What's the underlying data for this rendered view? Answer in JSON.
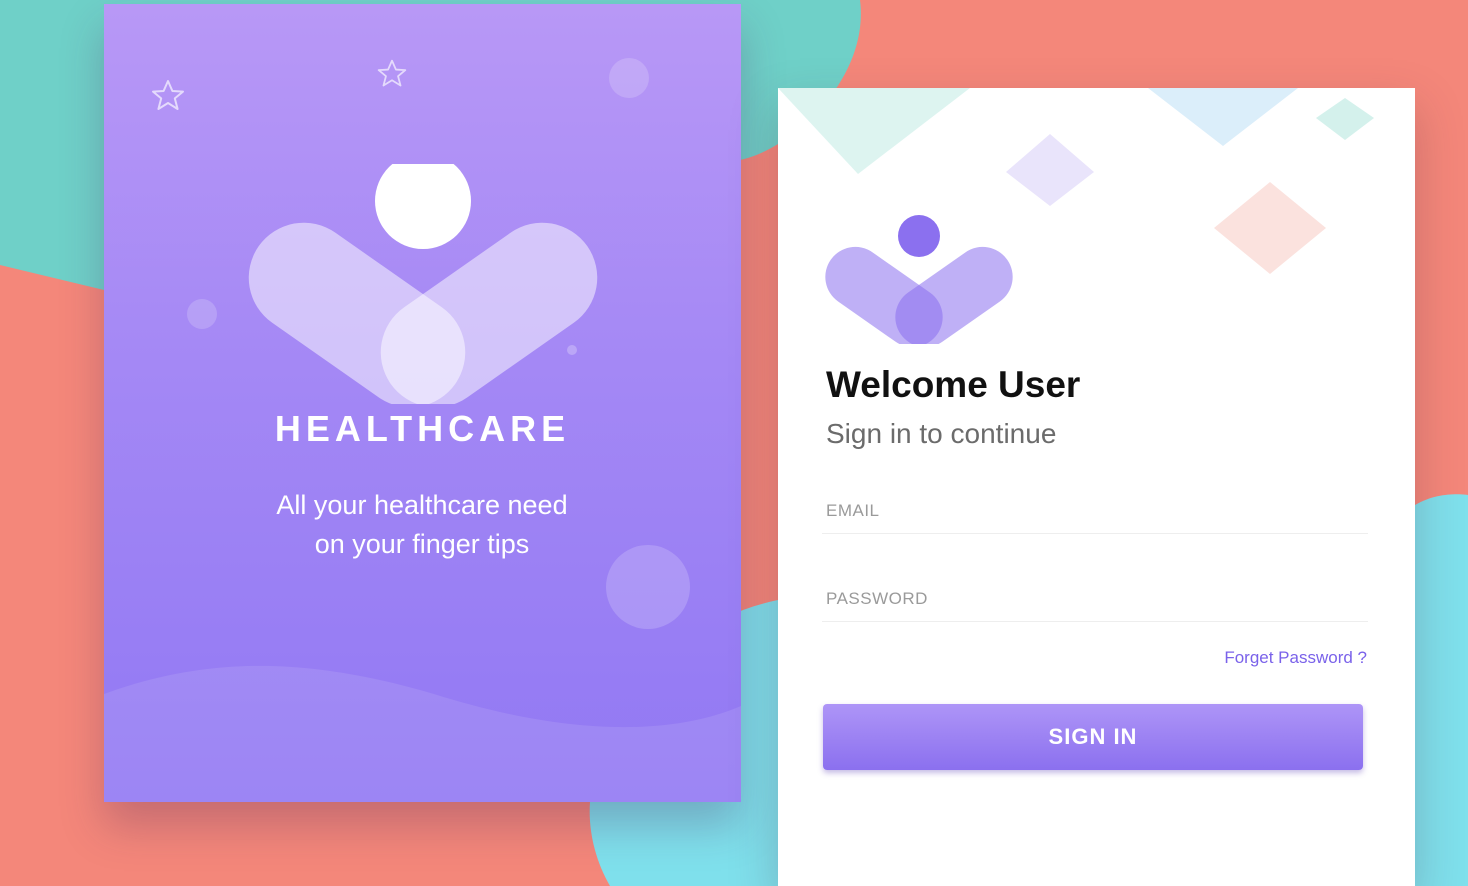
{
  "colors": {
    "background_coral": "#f4877a",
    "background_teal": "#6fd0c8",
    "background_cyan": "#7fe0ec",
    "accent_purple": "#8b70ef",
    "accent_purple_light": "#ae95f7"
  },
  "splash": {
    "brand_title": "HEALTHCARE",
    "tagline_line1": "All your healthcare need",
    "tagline_line2": "on your finger tips",
    "icons": [
      "star-outline-icon",
      "star-outline-icon",
      "heart-person-logo-icon"
    ]
  },
  "login": {
    "welcome": "Welcome User",
    "subtitle": "Sign in to continue",
    "email_placeholder": "EMAIL",
    "password_placeholder": "PASSWORD",
    "forget_password": "Forget Password ?",
    "signin_label": "SIGN IN",
    "icons": [
      "heart-person-logo-icon"
    ]
  }
}
